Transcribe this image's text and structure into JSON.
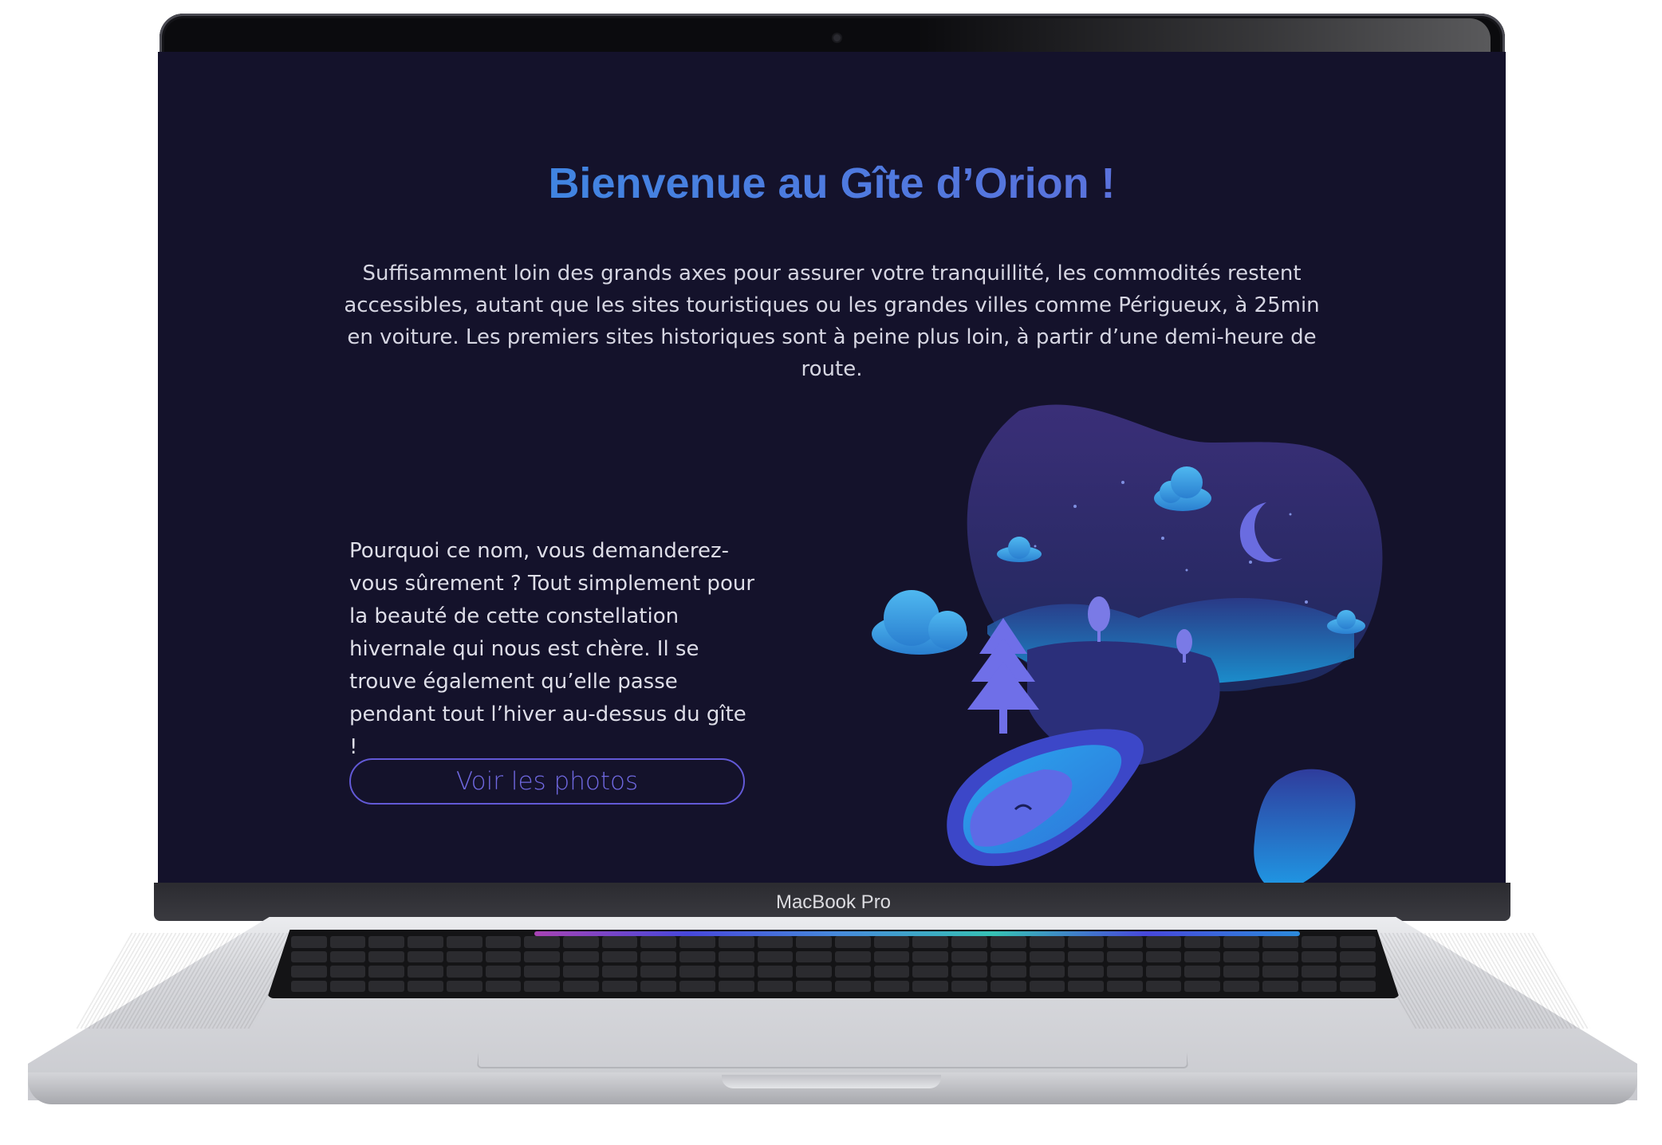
{
  "page": {
    "title": "Bienvenue au Gîte d’Orion !",
    "intro": "Suffisamment loin des grands axes pour assurer votre tranquillité, les commodités restent accessibles, autant que les sites touristiques ou les grandes villes comme Périgueux, à 25min en voiture. Les premiers sites historiques sont à peine plus loin, à partir d’une demi-heure de route.",
    "story": "Pourquoi ce nom, vous demanderez-vous sûrement ? Tout simplement pour la beauté de cette constellation hivernale qui nous est chère. Il se trouve également qu’elle passe pendant tout l’hiver au-dessus du gîte !",
    "cta_label": "Voir les photos"
  },
  "device": {
    "brand_label": "MacBook Pro"
  },
  "colors": {
    "background": "#14122b",
    "title_start": "#2d93e4",
    "title_end": "#6b66d8",
    "accent": "#6259d6",
    "text": "#d6d6e2"
  },
  "illustration": {
    "name": "night-landscape-illustration",
    "elements": [
      "cloud-icon",
      "moon-icon",
      "pine-tree-icon",
      "tree-icon",
      "pool-icon",
      "rock-icon"
    ]
  }
}
